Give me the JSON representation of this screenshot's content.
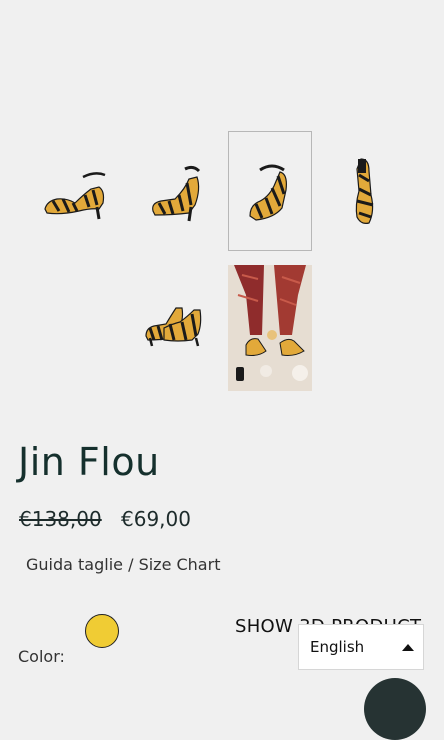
{
  "gallery": {
    "thumbnails": [
      {
        "view": "side-right",
        "selected": false
      },
      {
        "view": "front-angle",
        "selected": false
      },
      {
        "view": "back-angle",
        "selected": true
      },
      {
        "view": "top",
        "selected": false
      },
      {
        "view": "pair",
        "selected": false
      },
      {
        "view": "lifestyle",
        "selected": false
      }
    ]
  },
  "product": {
    "title": "Jin Flou",
    "price_original": "€138,00",
    "price_sale": "€69,00",
    "size_chart": "Guida taglie / Size Chart",
    "color_label": "Color:",
    "color_swatch": "#f0cc34",
    "show_3d": "SHOW 3D PRODUCT"
  },
  "language": {
    "selected": "English",
    "icon": "caret-up-icon"
  },
  "chat": {
    "icon": "chat-icon",
    "color": "#263333"
  }
}
